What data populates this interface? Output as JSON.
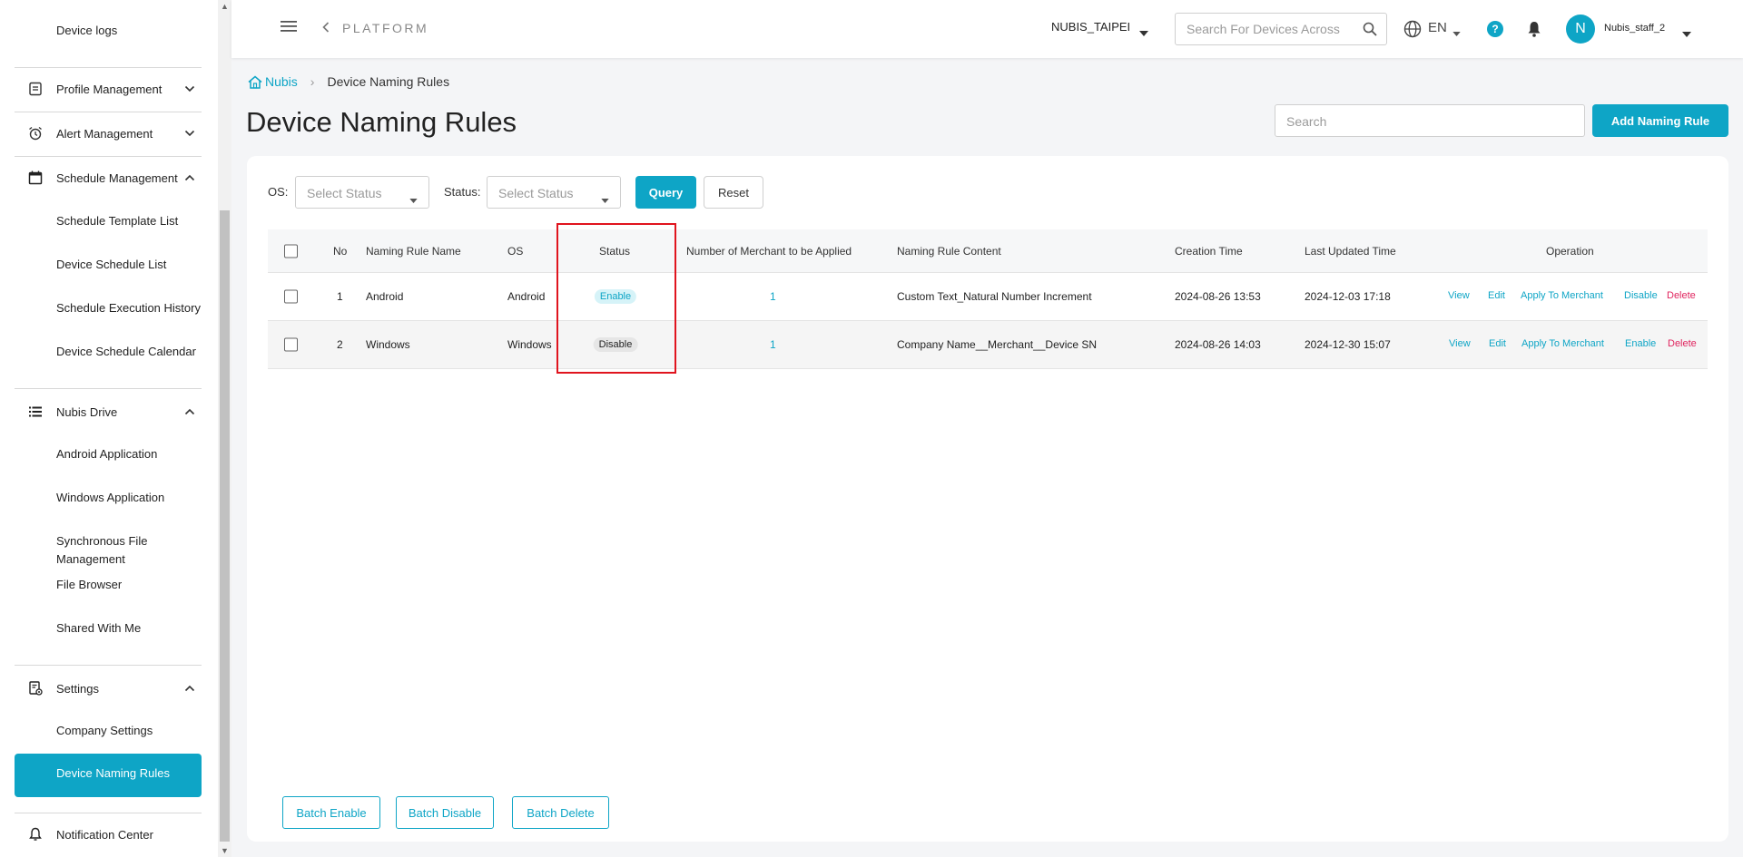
{
  "sidebar": {
    "items_top": [
      "Device logs"
    ],
    "groups": [
      {
        "label": "Profile Management",
        "icon": "profile-icon",
        "expanded": false
      },
      {
        "label": "Alert Management",
        "icon": "alarm-icon",
        "expanded": false
      },
      {
        "label": "Schedule Management",
        "icon": "calendar-icon",
        "expanded": true
      },
      {
        "label": "Nubis Drive",
        "icon": "list-icon",
        "expanded": true
      },
      {
        "label": "Settings",
        "icon": "settings-doc-icon",
        "expanded": true
      },
      {
        "label": "Notification Center",
        "icon": "bell-outline-icon"
      }
    ],
    "schedule_items": [
      "Schedule Template List",
      "Device Schedule List",
      "Schedule Execution History",
      "Device Schedule Calendar"
    ],
    "drive_items": [
      "Android Application",
      "Windows Application",
      "Synchronous File Management",
      "File Browser",
      "Shared With Me"
    ],
    "settings_items": [
      "Company Settings",
      "Device Naming Rules"
    ],
    "active": "Device Naming Rules"
  },
  "topbar": {
    "platform": "PLATFORM",
    "tenant": "NUBIS_TAIPEI",
    "search_placeholder": "Search For Devices Across",
    "language": "EN",
    "help": "?",
    "avatar_initial": "N",
    "username": "Nubis_staff_2"
  },
  "breadcrumb": {
    "home": "Nubis",
    "current": "Device Naming Rules"
  },
  "page": {
    "title": "Device Naming Rules",
    "search_placeholder": "Search",
    "add_button": "Add Naming Rule"
  },
  "filters": {
    "os_label": "OS:",
    "os_placeholder": "Select Status",
    "status_label": "Status:",
    "status_placeholder": "Select Status",
    "query": "Query",
    "reset": "Reset"
  },
  "table": {
    "headers": {
      "no": "No",
      "name": "Naming Rule Name",
      "os": "OS",
      "status": "Status",
      "merchants": "Number of Merchant to be Applied",
      "content": "Naming Rule Content",
      "created": "Creation Time",
      "updated": "Last Updated Time",
      "operation": "Operation"
    },
    "rows": [
      {
        "no": "1",
        "name": "Android",
        "os": "Android",
        "status": "Enable",
        "merchants": "1",
        "content": "Custom Text_Natural Number Increment",
        "created": "2024-08-26 13:53",
        "updated": "2024-12-03 17:18",
        "ops": {
          "view": "View",
          "edit": "Edit",
          "apply": "Apply To Merchant",
          "toggle": "Disable",
          "delete": "Delete"
        }
      },
      {
        "no": "2",
        "name": "Windows",
        "os": "Windows",
        "status": "Disable",
        "merchants": "1",
        "content": "Company Name__Merchant__Device SN",
        "created": "2024-08-26 14:03",
        "updated": "2024-12-30 15:07",
        "ops": {
          "view": "View",
          "edit": "Edit",
          "apply": "Apply To Merchant",
          "toggle": "Enable",
          "delete": "Delete"
        }
      }
    ]
  },
  "batch": {
    "enable": "Batch Enable",
    "disable": "Batch Disable",
    "delete": "Batch Delete"
  },
  "colors": {
    "accent": "#0ea5c6",
    "danger": "#e0245e",
    "highlight": "#e0141e"
  }
}
